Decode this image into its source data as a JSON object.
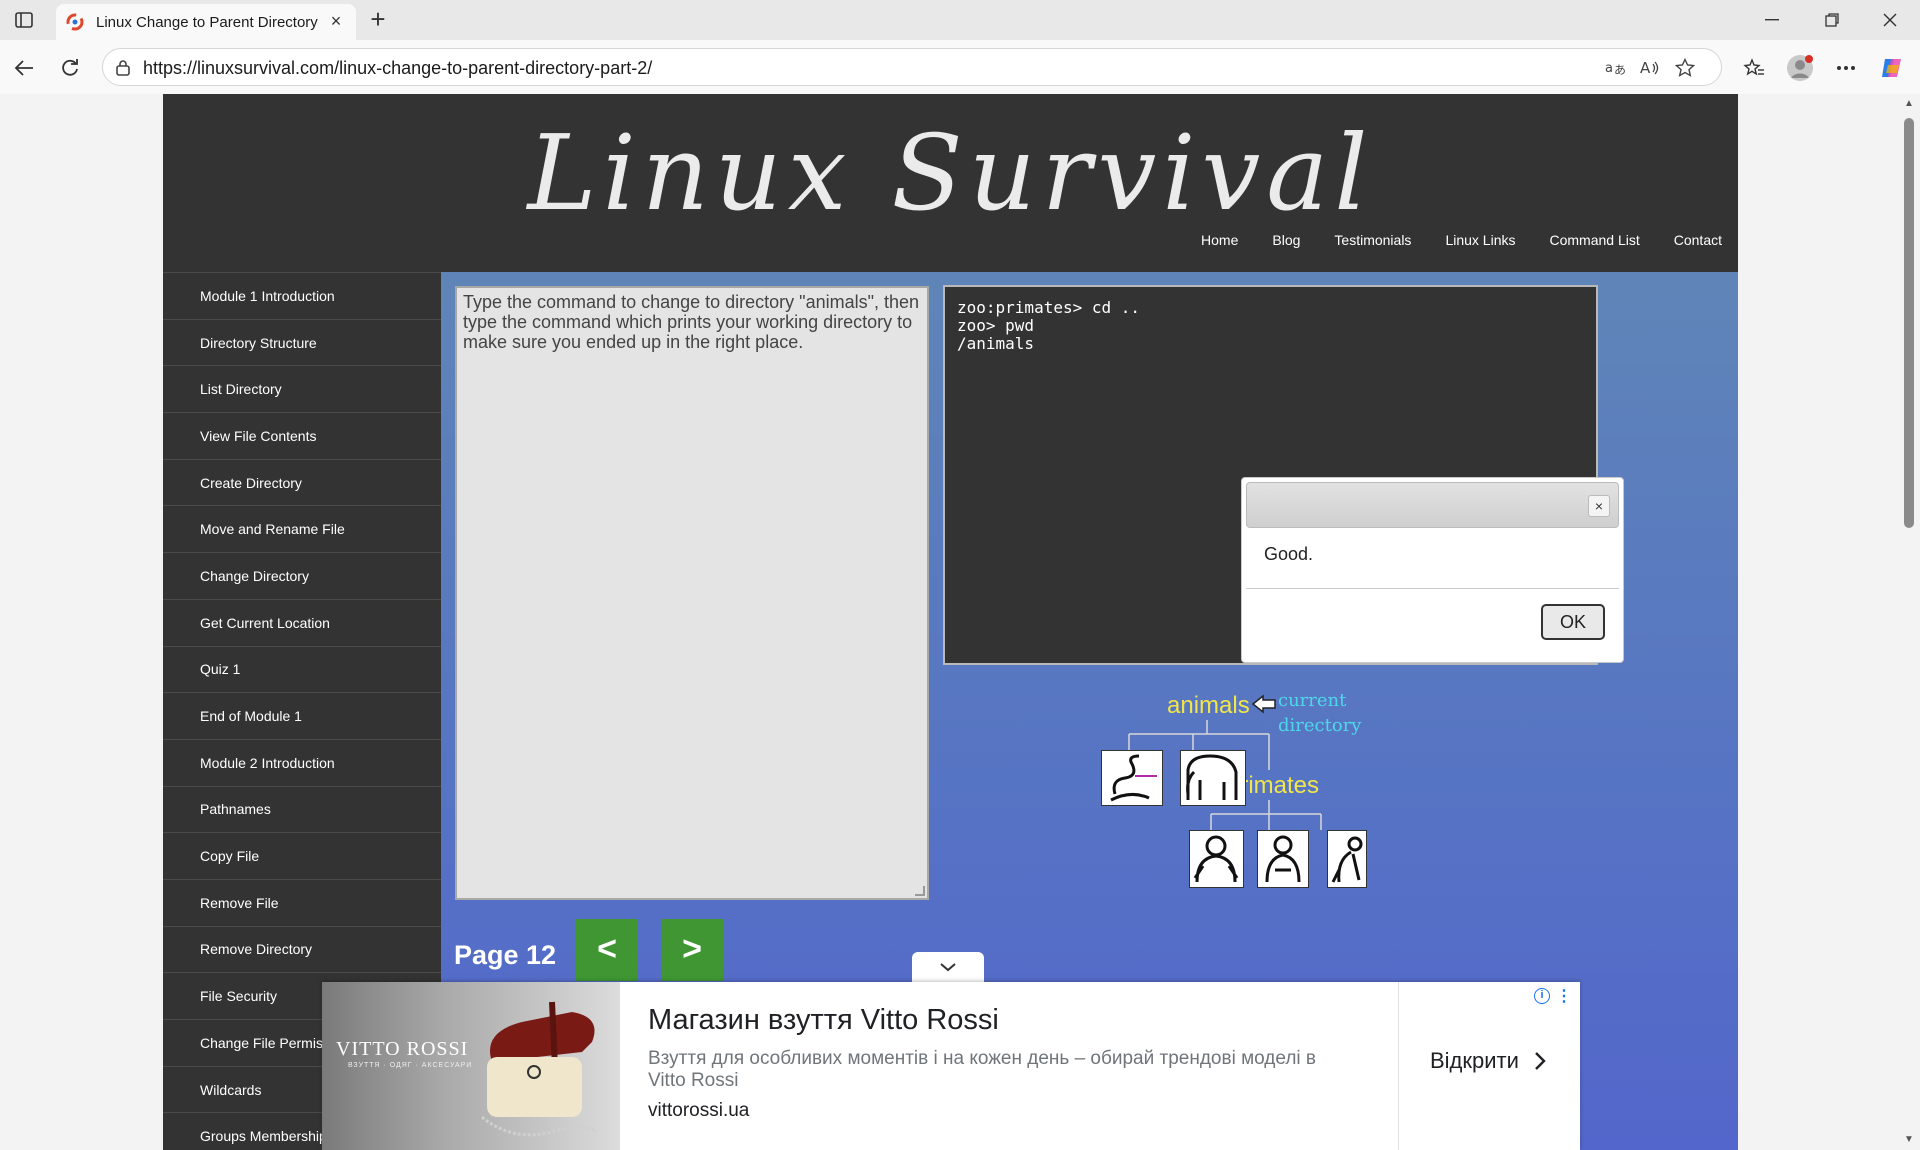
{
  "browser": {
    "tab_title": "Linux Change to Parent Directory",
    "url": "https://linuxsurvival.com/linux-change-to-parent-directory-part-2/"
  },
  "site": {
    "logo": "Linux Survival",
    "nav": [
      "Home",
      "Blog",
      "Testimonials",
      "Linux Links",
      "Command List",
      "Contact"
    ],
    "sidebar": [
      "Module 1 Introduction",
      "Directory Structure",
      "List Directory",
      "View File Contents",
      "Create Directory",
      "Move and Rename File",
      "Change Directory",
      "Get Current Location",
      "Quiz 1",
      "End of Module 1",
      "Module 2 Introduction",
      "Pathnames",
      "Copy File",
      "Remove File",
      "Remove Directory",
      "File Security",
      "Change File Permissions",
      "Wildcards",
      "Groups Membership"
    ]
  },
  "lesson": {
    "instructions": "Type the command to change to directory \"animals\", then type the command which prints your working directory to make sure you ended up in the right place.",
    "terminal_lines": [
      "zoo:primates> cd ..",
      "zoo> pwd",
      "/animals"
    ],
    "dialog": {
      "message": "Good.",
      "ok_label": "OK",
      "close_label": "×"
    },
    "diagram": {
      "root_label": "animals",
      "pointer_label_1": "current",
      "pointer_label_2": "directory",
      "child_label": "primates"
    },
    "pager": {
      "label": "Page 12",
      "prev": "<",
      "next": ">"
    }
  },
  "ad": {
    "brand": "VITTO ROSSI",
    "brand_sub": "ВЗУТТЯ · ОДЯГ · АКСЕСУАРИ",
    "title": "Магазин взуття Vitto Rossi",
    "description": "Взуття для особливих моментів і на кожен день – обирай трендові моделі в Vitto Rossi",
    "domain": "vittorossi.ua",
    "cta": "Відкрити",
    "info": "i"
  },
  "colors": {
    "header_bg": "#333333",
    "content_gradient_top": "#5f85b8",
    "content_gradient_bottom": "#5366cb",
    "pager_button": "#3f9632",
    "diagram_yellow": "#f0e64a",
    "diagram_cyan": "#4fd7e9"
  }
}
